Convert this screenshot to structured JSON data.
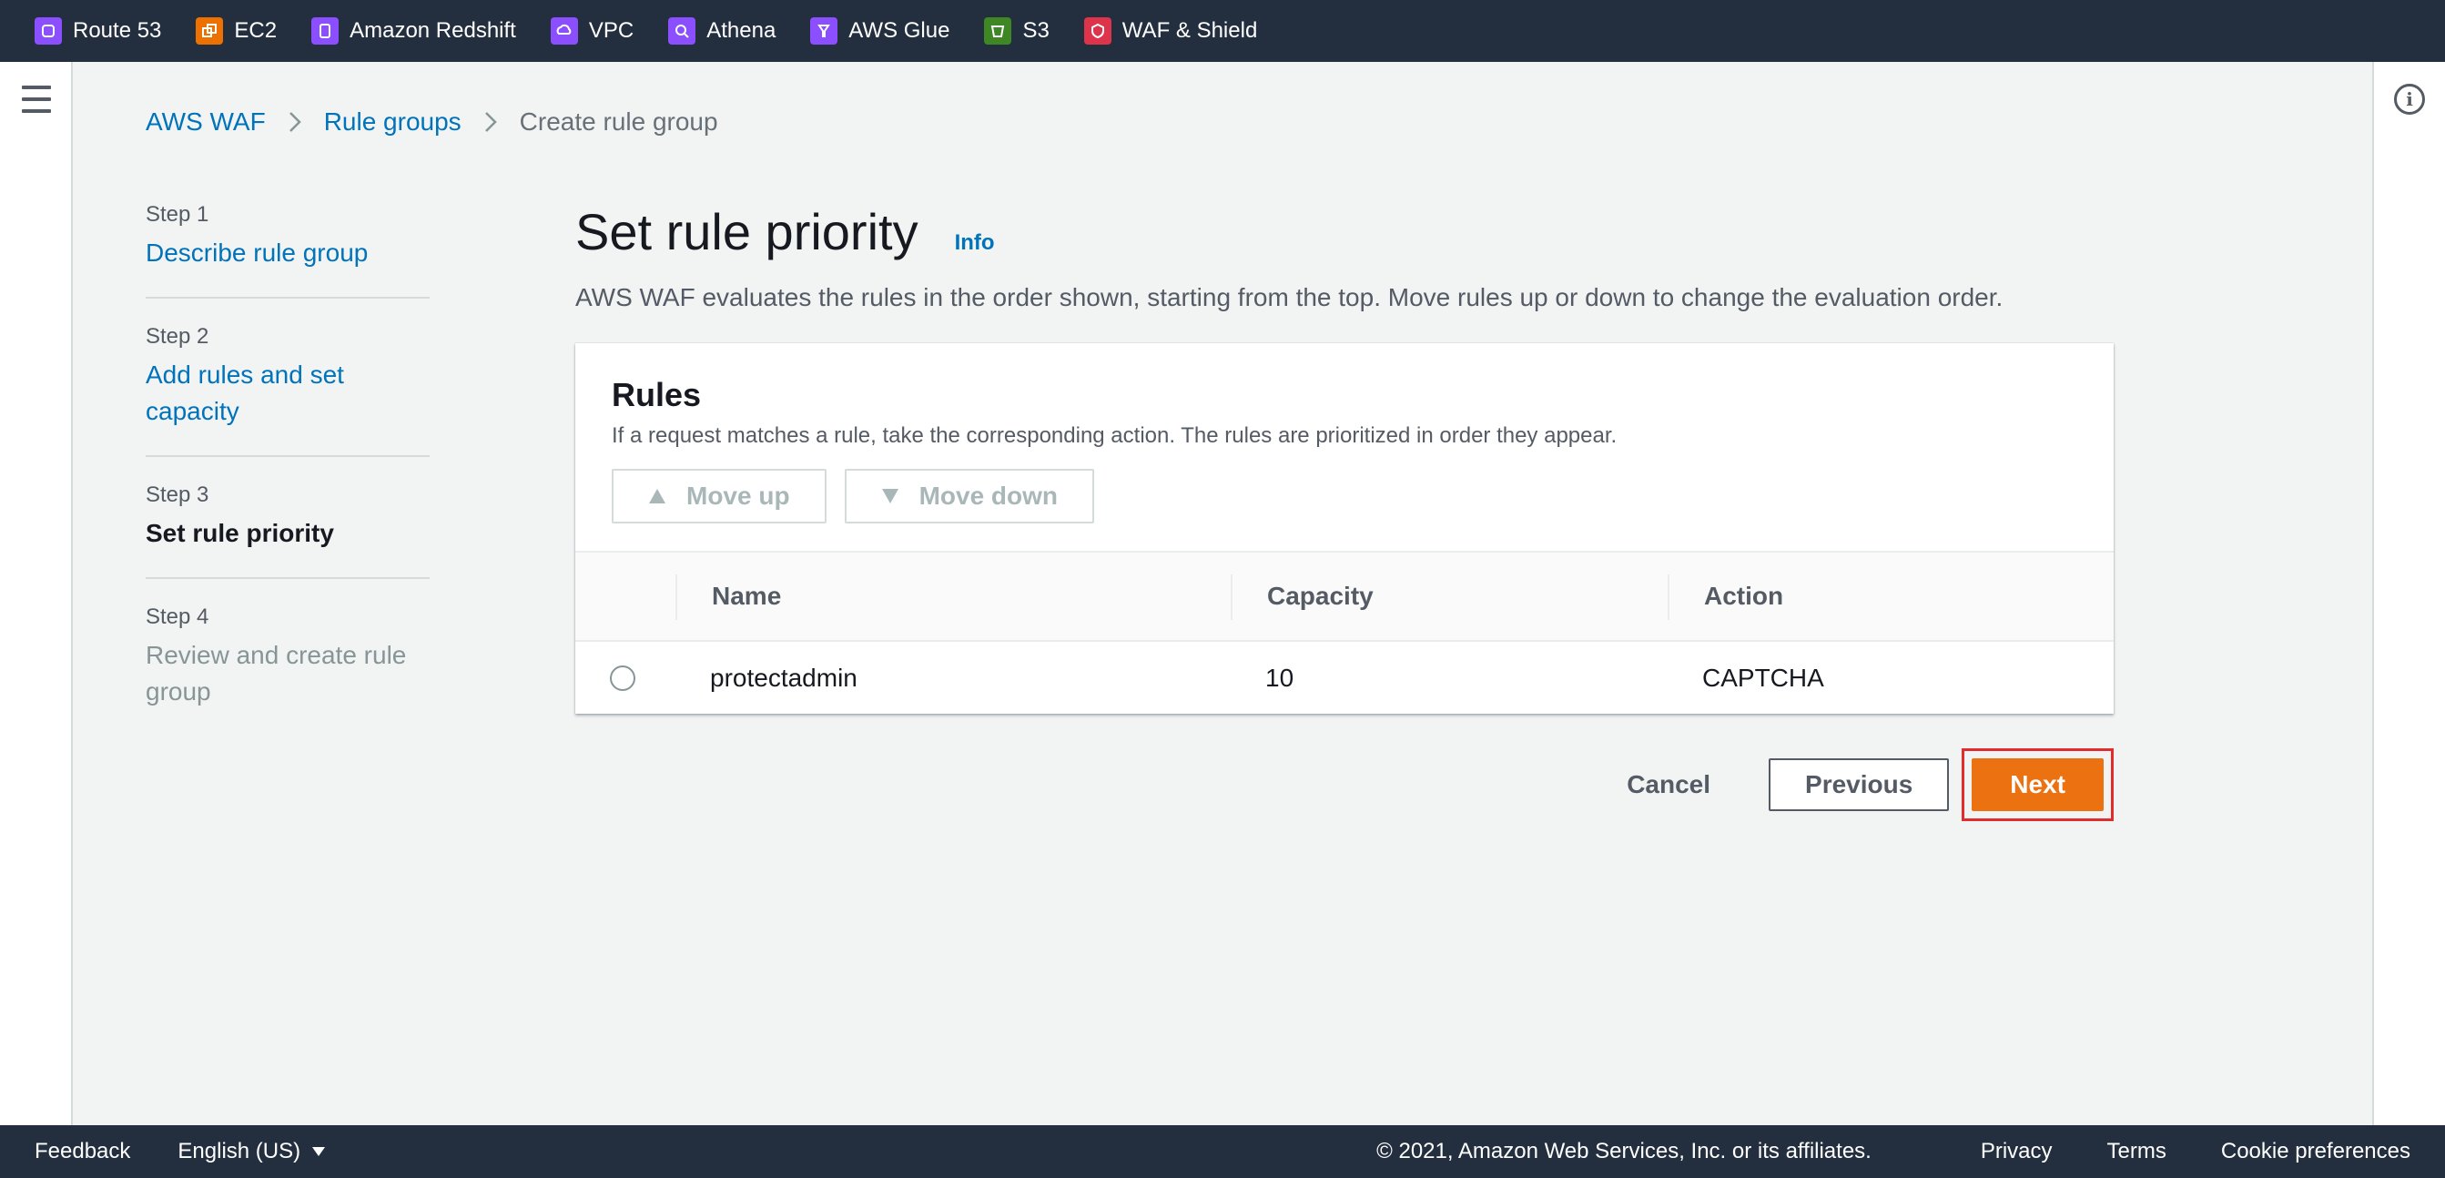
{
  "favorites": [
    {
      "label": "Route 53",
      "icon": "route53-icon",
      "color": "#8c4fff"
    },
    {
      "label": "EC2",
      "icon": "ec2-icon",
      "color": "#ed7100"
    },
    {
      "label": "Amazon Redshift",
      "icon": "redshift-icon",
      "color": "#8c4fff"
    },
    {
      "label": "VPC",
      "icon": "vpc-icon",
      "color": "#8c4fff"
    },
    {
      "label": "Athena",
      "icon": "athena-icon",
      "color": "#8c4fff"
    },
    {
      "label": "AWS Glue",
      "icon": "glue-icon",
      "color": "#8c4fff"
    },
    {
      "label": "S3",
      "icon": "s3-icon",
      "color": "#3f8624"
    },
    {
      "label": "WAF & Shield",
      "icon": "waf-icon",
      "color": "#dd344c"
    }
  ],
  "breadcrumb": {
    "items": [
      "AWS WAF",
      "Rule groups"
    ],
    "current": "Create rule group"
  },
  "steps": [
    {
      "num": "Step 1",
      "label": "Describe rule group",
      "state": "link"
    },
    {
      "num": "Step 2",
      "label": "Add rules and set capacity",
      "state": "link"
    },
    {
      "num": "Step 3",
      "label": "Set rule priority",
      "state": "active"
    },
    {
      "num": "Step 4",
      "label": "Review and create rule group",
      "state": "disabled"
    }
  ],
  "main": {
    "title": "Set rule priority",
    "info_label": "Info",
    "description": "AWS WAF evaluates the rules in the order shown, starting from the top. Move rules up or down to change the evaluation order."
  },
  "rules_panel": {
    "title": "Rules",
    "description": "If a request matches a rule, take the corresponding action. The rules are prioritized in order they appear.",
    "move_up_label": "Move up",
    "move_down_label": "Move down",
    "columns": [
      "Name",
      "Capacity",
      "Action"
    ],
    "rows": [
      {
        "name": "protectadmin",
        "capacity": "10",
        "action": "CAPTCHA"
      }
    ]
  },
  "actions": {
    "cancel_label": "Cancel",
    "previous_label": "Previous",
    "next_label": "Next"
  },
  "footer": {
    "feedback": "Feedback",
    "language": "English (US)",
    "copyright": "© 2021, Amazon Web Services, Inc. or its affiliates.",
    "privacy": "Privacy",
    "terms": "Terms",
    "cookies": "Cookie preferences"
  },
  "colors": {
    "header_bg": "#232f3e",
    "link": "#0073bb",
    "primary": "#ec7211",
    "highlight": "#e02c2c"
  }
}
